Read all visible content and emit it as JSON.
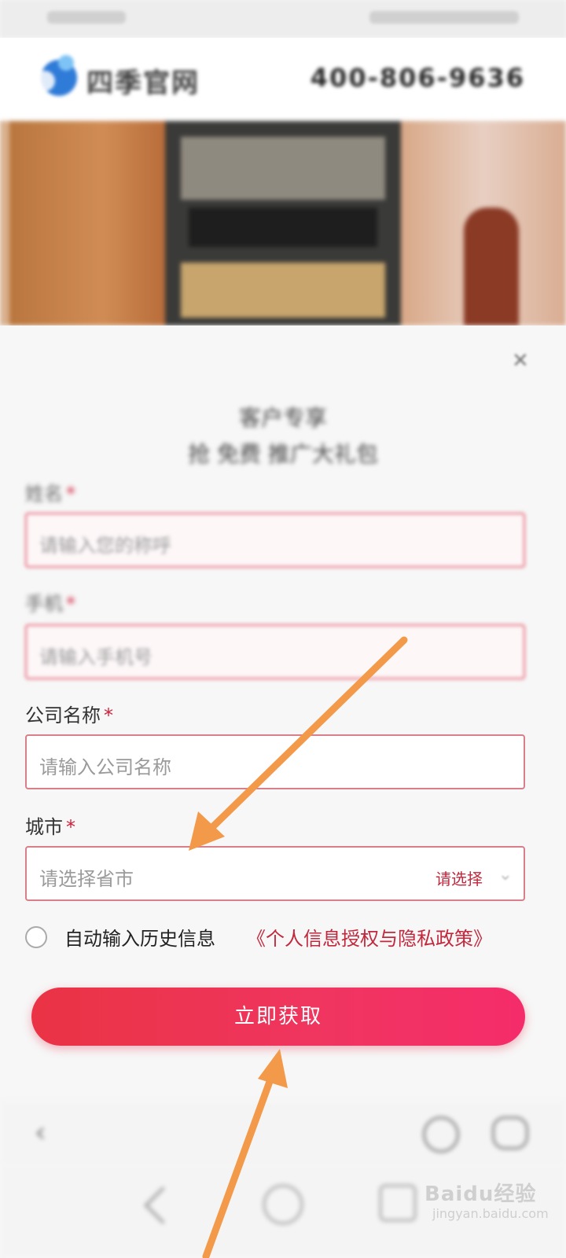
{
  "header": {
    "brand": "四季官网",
    "phone": "400-806-9636"
  },
  "form": {
    "close_icon": "close-icon",
    "title_line1": "客户专享",
    "title_line2": "抢 免费 推广大礼包",
    "fields": [
      {
        "label": "姓名",
        "required": "*",
        "placeholder": "请输入您的称呼"
      },
      {
        "label": "手机",
        "required": "*",
        "placeholder": "请输入手机号"
      },
      {
        "label": "公司名称",
        "required": "*",
        "placeholder": "请输入公司名称"
      },
      {
        "label": "城市",
        "required": "*",
        "placeholder": "请选择省市",
        "select_hint": "请选择"
      }
    ],
    "auto_fill_text": "自动输入历史信息",
    "policy_text": "《个人信息授权与隐私政策》",
    "submit_label": "立即获取"
  },
  "watermark": {
    "text": "Baidu经验",
    "subtext": "jingyan.baidu.com"
  },
  "annotation_color": "#f39a4a"
}
